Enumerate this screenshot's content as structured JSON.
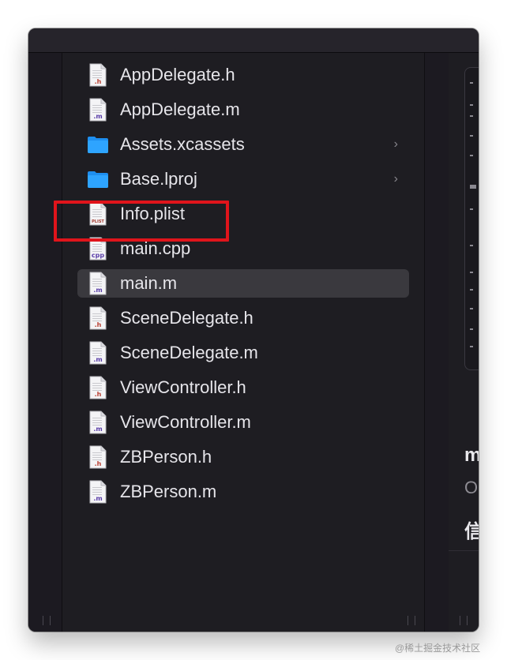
{
  "files": [
    {
      "name": "AppDelegate.h",
      "kind": "doc",
      "badge": ".h",
      "badge_color": "#b94033",
      "has_chevron": false,
      "selected": false,
      "highlighted": false
    },
    {
      "name": "AppDelegate.m",
      "kind": "doc",
      "badge": ".m",
      "badge_color": "#5a3ea8",
      "has_chevron": false,
      "selected": false,
      "highlighted": false
    },
    {
      "name": "Assets.xcassets",
      "kind": "folder",
      "badge": "",
      "badge_color": "",
      "has_chevron": true,
      "selected": false,
      "highlighted": false
    },
    {
      "name": "Base.lproj",
      "kind": "folder",
      "badge": "",
      "badge_color": "",
      "has_chevron": true,
      "selected": false,
      "highlighted": false
    },
    {
      "name": "Info.plist",
      "kind": "doc",
      "badge": "PLIST",
      "badge_color": "#a33a2f",
      "has_chevron": false,
      "selected": false,
      "highlighted": false
    },
    {
      "name": "main.cpp",
      "kind": "doc",
      "badge": "cpp",
      "badge_color": "#5a3ea8",
      "has_chevron": false,
      "selected": false,
      "highlighted": true
    },
    {
      "name": "main.m",
      "kind": "doc",
      "badge": ".m",
      "badge_color": "#5a3ea8",
      "has_chevron": false,
      "selected": true,
      "highlighted": false
    },
    {
      "name": "SceneDelegate.h",
      "kind": "doc",
      "badge": ".h",
      "badge_color": "#b94033",
      "has_chevron": false,
      "selected": false,
      "highlighted": false
    },
    {
      "name": "SceneDelegate.m",
      "kind": "doc",
      "badge": ".m",
      "badge_color": "#5a3ea8",
      "has_chevron": false,
      "selected": false,
      "highlighted": false
    },
    {
      "name": "ViewController.h",
      "kind": "doc",
      "badge": ".h",
      "badge_color": "#b94033",
      "has_chevron": false,
      "selected": false,
      "highlighted": false
    },
    {
      "name": "ViewController.m",
      "kind": "doc",
      "badge": ".m",
      "badge_color": "#5a3ea8",
      "has_chevron": false,
      "selected": false,
      "highlighted": false
    },
    {
      "name": "ZBPerson.h",
      "kind": "doc",
      "badge": ".h",
      "badge_color": "#b94033",
      "has_chevron": false,
      "selected": false,
      "highlighted": false
    },
    {
      "name": "ZBPerson.m",
      "kind": "doc",
      "badge": ".m",
      "badge_color": "#5a3ea8",
      "has_chevron": false,
      "selected": false,
      "highlighted": false
    }
  ],
  "chevron_glyph": "›",
  "preview_panel": {
    "title_fragment": "m",
    "subtitle_fragment": "O",
    "section_fragment": "信"
  },
  "watermark": "@稀土掘金技术社区",
  "colors": {
    "window_bg": "#1c1a21",
    "selection_bg": "#3a393e",
    "highlight_border": "#e0141b",
    "folder_blue": "#1e8ff0",
    "text_primary": "#e6e5ea"
  }
}
